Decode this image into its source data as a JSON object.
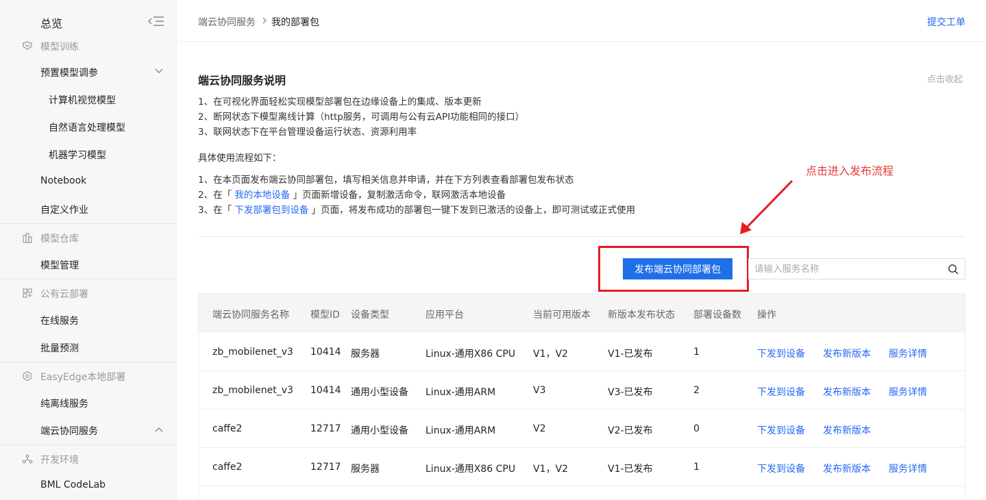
{
  "sidebar": {
    "title": "总览",
    "groups": {
      "training": "模型训练",
      "repo": "模型仓库",
      "public": "公有云部署",
      "easyedge": "EasyEdge本地部署",
      "dev": "开发环境"
    },
    "items": {
      "preset": "预置模型调参",
      "cv": "计算机视觉模型",
      "nlp": "自然语言处理模型",
      "ml": "机器学习模型",
      "notebook": "Notebook",
      "custom": "自定义作业",
      "model_mgmt": "模型管理",
      "online": "在线服务",
      "batch": "批量预测",
      "offline": "纯离线服务",
      "edge_cloud": "端云协同服务",
      "codelab": "BML CodeLab"
    }
  },
  "header": {
    "breadcrumb_parent": "端云协同服务",
    "breadcrumb_current": "我的部署包",
    "submit_ticket": "提交工单"
  },
  "description": {
    "title": "端云协同服务说明",
    "collapse": "点击收起",
    "points": [
      "1、在可视化界面轻松实现模型部署包在边缘设备上的集成、版本更新",
      "2、断网状态下模型离线计算（http服务，可调用与公有云API功能相同的接口）",
      "3、联网状态下在平台管理设备运行状态、资源利用率"
    ],
    "flow_title": "具体使用流程如下：",
    "step1": "1、在本页面发布端云协同部署包，填写相关信息并申请，并在下方列表查看部署包发布状态",
    "step2_pre": "2、在「 ",
    "step2_link": "我的本地设备",
    "step2_post": " 」页面新增设备，复制激活命令，联网激活本地设备",
    "step3_pre": "3、在「 ",
    "step3_link": "下发部署包到设备",
    "step3_post": " 」页面，将发布成功的部署包一键下发到已激活的设备上，即可测试或正式使用"
  },
  "annotation": {
    "text": "点击进入发布流程",
    "color": "#e53935"
  },
  "toolbar": {
    "publish_label": "发布端云协同部署包",
    "search_placeholder": "请输入服务名称"
  },
  "table": {
    "headers": {
      "name": "端云协同服务名称",
      "model_id": "模型ID",
      "device_type": "设备类型",
      "platform": "应用平台",
      "version": "当前可用版本",
      "status": "新版本发布状态",
      "devices": "部署设备数",
      "ops": "操作"
    },
    "rows": [
      {
        "name": "zb_mobilenet_v3",
        "model_id": "10414",
        "device_type": "服务器",
        "platform": "Linux-通用X86 CPU",
        "version": "V1，V2",
        "status": "V1-已发布",
        "devices": "1",
        "op1": "下发到设备",
        "op2": "发布新版本",
        "op3": "服务详情"
      },
      {
        "name": "zb_mobilenet_v3",
        "model_id": "10414",
        "device_type": "通用小型设备",
        "platform": "Linux-通用ARM",
        "version": "V3",
        "status": "V3-已发布",
        "devices": "2",
        "op1": "下发到设备",
        "op2": "发布新版本",
        "op3": "服务详情"
      },
      {
        "name": "caffe2",
        "model_id": "12717",
        "device_type": "通用小型设备",
        "platform": "Linux-通用ARM",
        "version": "V2",
        "status": "V2-已发布",
        "devices": "0",
        "op1": "下发到设备",
        "op2": "发布新版本",
        "op3": ""
      },
      {
        "name": "caffe2",
        "model_id": "12717",
        "device_type": "服务器",
        "platform": "Linux-通用X86 CPU",
        "version": "V1，V2",
        "status": "V1-已发布",
        "devices": "1",
        "op1": "下发到设备",
        "op2": "发布新版本",
        "op3": "服务详情"
      }
    ]
  },
  "colors": {
    "accent": "#2468f2",
    "primary_button": "#1f6fe8",
    "highlight_box": "#e51c23"
  }
}
